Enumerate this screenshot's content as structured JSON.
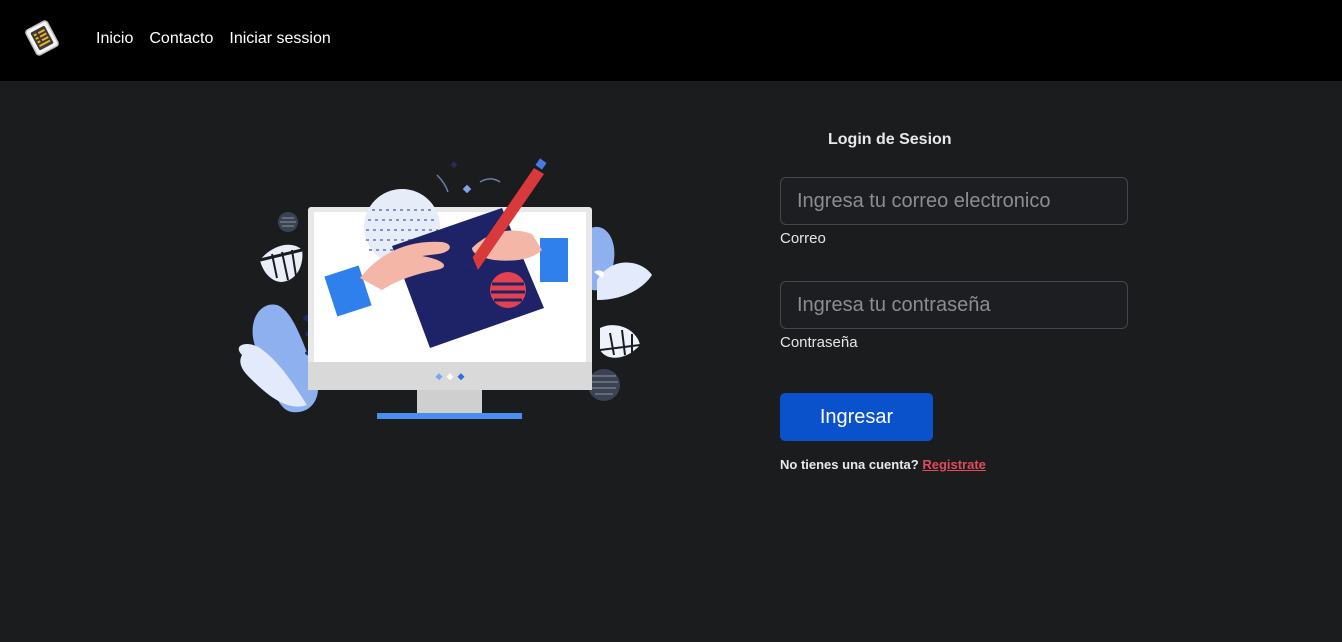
{
  "nav": {
    "links": [
      "Inicio",
      "Contacto",
      "Iniciar session"
    ]
  },
  "login": {
    "title": "Login de Sesion",
    "email_placeholder": "Ingresa tu correo electronico",
    "email_label": "Correo",
    "password_placeholder": "Ingresa tu contraseña",
    "password_label": "Contraseña",
    "submit_label": "Ingresar",
    "register_prompt": "No tienes una cuenta?",
    "register_link": "Registrate"
  },
  "colors": {
    "navbar": "#000000",
    "background": "#1b1c1e",
    "button": "#0a52cc",
    "link": "#e24b5c"
  }
}
